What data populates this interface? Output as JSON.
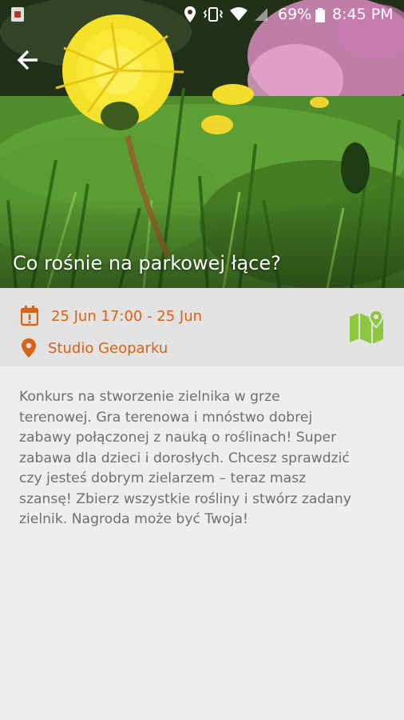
{
  "status_bar": {
    "battery": "69%",
    "time": "8:45 PM",
    "icons": [
      "notification-icon",
      "location-icon",
      "vibrate-icon",
      "wifi-icon",
      "signal-icon",
      "battery-icon"
    ]
  },
  "header": {
    "back_icon": "arrow-back-icon",
    "title": "Co rośnie na parkowej łące?"
  },
  "event": {
    "date": "25 Jun 17:00 - 25 Jun",
    "location": "Studio Geoparku",
    "map_icon": "map-pin-icon"
  },
  "description": [
    "Konkurs na stworzenie zielnika w grze",
    "terenowej. Gra terenowa i mnóstwo dobrej",
    "zabawy połączonej z nauką o roślinach! Super",
    "zabawa dla dzieci i dorosłych. Chcesz sprawdzić",
    "czy jesteś dobrym zielarzem – teraz masz",
    "szansę! Zbierz wszystkie rośliny i stwórz zadany",
    "zielnik. Nagroda może być Twoja!"
  ],
  "colors": {
    "accent": "#d86312",
    "map_green": "#8dc63f",
    "info_bg": "#e2e2e2",
    "page_bg": "#eeeeee",
    "text": "#6f6f6f"
  }
}
